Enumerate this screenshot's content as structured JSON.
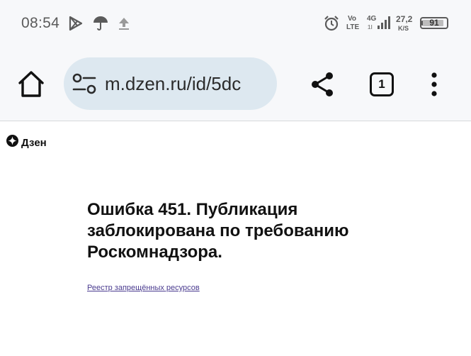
{
  "status_bar": {
    "time": "08:54",
    "network_vo": "Vo",
    "network_lte": "LTE",
    "network_4g": "4G",
    "network_sub": "1l",
    "speed_value": "27,2",
    "speed_unit": "K/S",
    "battery_level": 91,
    "battery_text": "91",
    "left_icons": [
      "play-store-icon",
      "umbrella-icon",
      "upload-icon"
    ],
    "right_icons": [
      "alarm-icon",
      "signal-icon",
      "battery-icon"
    ]
  },
  "toolbar": {
    "url": "m.dzen.ru/id/5dc",
    "tab_count": "1",
    "icons": [
      "home-icon",
      "site-settings-icon",
      "share-icon",
      "tabs-icon",
      "more-vert-icon"
    ]
  },
  "page": {
    "logo_text": "Дзен",
    "error_title": "Ошибка 451. Публикация заблокирована по требованию Роскомнадзора.",
    "registry_link": "Реестр запрещённых ресурсов"
  },
  "colors": {
    "chrome_bg": "#f7f8fa",
    "url_bar_bg": "#dde8f0",
    "link": "#4a3b8f",
    "text": "#111111"
  }
}
